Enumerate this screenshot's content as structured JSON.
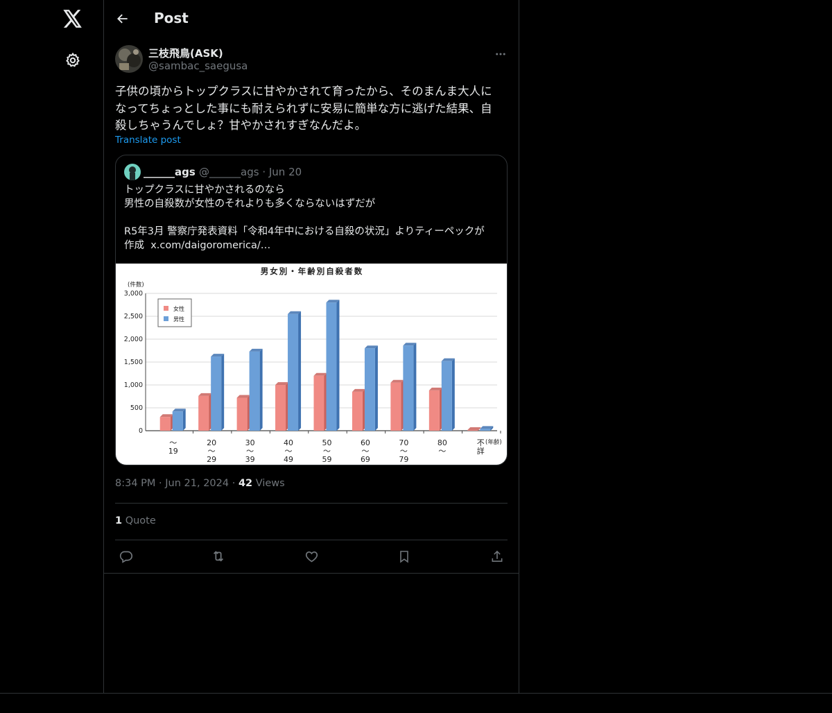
{
  "nav": {
    "logo_icon": "x-logo-icon",
    "settings_icon": "gear-icon"
  },
  "header": {
    "title": "Post"
  },
  "post": {
    "author_name": "三枝飛鳥(ASK)",
    "author_handle": "@sambac_saegusa",
    "text": "子供の頃からトップクラスに甘やかされて育ったから、そのまんま大人に\nなってちょっとした事にも耐えられずに安易に簡単な方に逃げた結果、自\n殺しちゃうんでしょ？甘やかされすぎなんだよ。",
    "translate_label": "Translate post",
    "time": "8:34 PM",
    "date": "Jun 21, 2024",
    "views_count": "42",
    "views_label": "Views",
    "quotes_count": "1",
    "quotes_label": "Quote"
  },
  "quoted": {
    "name": "______ags",
    "handle": "@______ags",
    "date": "Jun 20",
    "text": "トップクラスに甘やかされるのなら\n男性の自殺数が女性のそれよりも多くならないはずだが\n\nR5年3月 警察庁発表資料「令和4年中における自殺の状況」よりティーペックが\n作成  x.com/daigoromerica/…"
  },
  "chart_data": {
    "type": "bar",
    "title": "男女別・年齢別自殺者数",
    "ylabel": "(件数)",
    "xlabel": "(年齢)",
    "ylim": [
      0,
      3000
    ],
    "yticks": [
      "3,000",
      "2,500",
      "2,000",
      "1,500",
      "1,000",
      "500",
      "0"
    ],
    "categories": [
      [
        "〜",
        "19"
      ],
      [
        "20",
        "〜",
        "29"
      ],
      [
        "30",
        "〜",
        "39"
      ],
      [
        "40",
        "〜",
        "49"
      ],
      [
        "50",
        "〜",
        "59"
      ],
      [
        "60",
        "〜",
        "69"
      ],
      [
        "70",
        "〜",
        "79"
      ],
      [
        "80",
        "〜"
      ],
      [
        "不",
        "詳"
      ]
    ],
    "series": [
      {
        "name": "女性",
        "color": "#f08a84",
        "values": [
          300,
          760,
          720,
          1000,
          1200,
          850,
          1050,
          880,
          15
        ]
      },
      {
        "name": "男性",
        "color": "#6b9fd8",
        "values": [
          420,
          1620,
          1730,
          2550,
          2800,
          1800,
          1860,
          1520,
          40
        ]
      }
    ],
    "legend": "top-left",
    "grid": true
  }
}
